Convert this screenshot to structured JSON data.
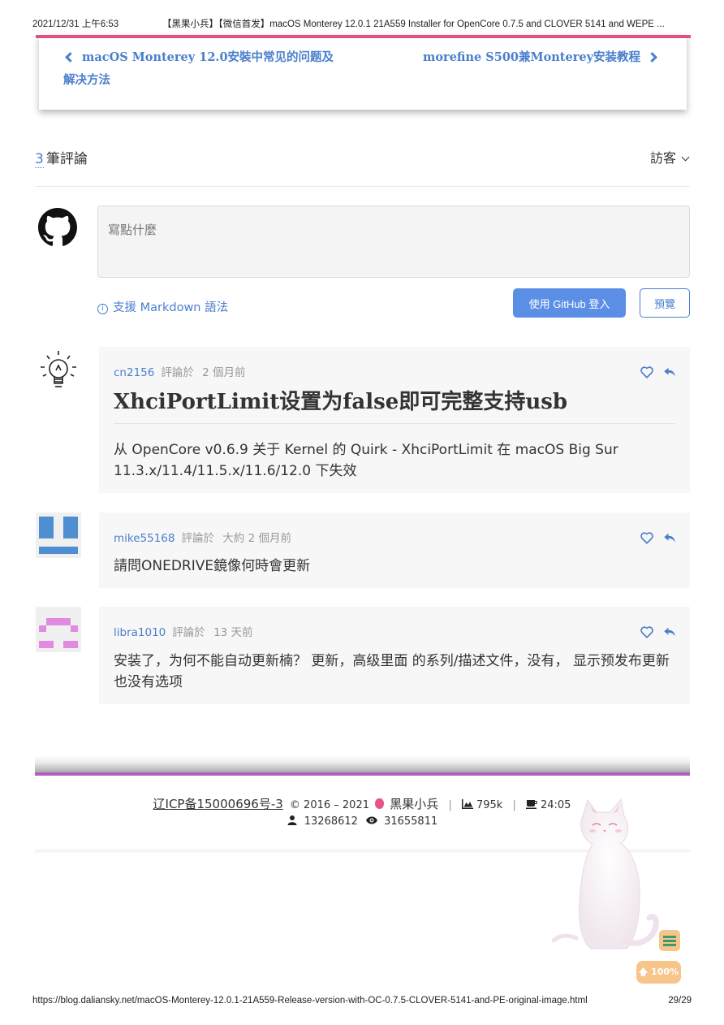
{
  "print_header": {
    "datetime": "2021/12/31 上午6:53",
    "title": "【黑果小兵】【微信首发】macOS Monterey 12.0.1 21A559 Installer for OpenCore 0.7.5 and CLOVER 5141 and WEPE ..."
  },
  "post_nav": {
    "prev": "macOS Monterey 12.0安裝中常见的问题及解决方法",
    "next": "morefine S500兼Monterey安装教程",
    "accent": "#e0517c"
  },
  "comments_header": {
    "count": "3",
    "count_label": "筆評論",
    "guest_label": "訪客"
  },
  "editor": {
    "placeholder": "寫點什麼",
    "markdown_hint": "支援 Markdown 語法",
    "login_button": "使用 GitHub 登入",
    "preview_button": "預覽"
  },
  "comments": [
    {
      "user": "cn2156",
      "verb": "評論於",
      "time": "2 個月前",
      "heading": "XhciPortLimit设置为false即可完整支持usb",
      "body": "从 OpenCore v0.6.9 关于 Kernel 的 Quirk - XhciPortLimit 在 macOS Big Sur 11.3.x/11.4/11.5.x/11.6/12.0 下失效"
    },
    {
      "user": "mike55168",
      "verb": "評論於",
      "time": "大約 2 個月前",
      "body": "請問ONEDRIVE鏡像何時會更新"
    },
    {
      "user": "libra1010",
      "verb": "評論於",
      "time": "13 天前",
      "body": "安装了，为何不能自动更新楠？ 更新，高级里面 的系列/描述文件，没有， 显示预发布更新也没有选项"
    }
  ],
  "footer": {
    "icp": "辽ICP备15000696号-3",
    "copyright": "© 2016 – 2021",
    "site_name": "黑果小兵",
    "words": "795k",
    "reading_time": "24:05",
    "visitors": "13268612",
    "views": "31655811"
  },
  "float_buttons": {
    "top_label": "100%"
  },
  "print_footer": {
    "url": "https://blog.daliansky.net/macOS-Monterey-12.0.1-21A559-Release-version-with-OC-0.7.5-CLOVER-5141-and-PE-original-image.html",
    "page": "29/29"
  },
  "colors": {
    "link": "#4a7fcc",
    "button": "#5b8fe6",
    "footer_bar": "#b25ec2",
    "float": "#f7c58a"
  }
}
